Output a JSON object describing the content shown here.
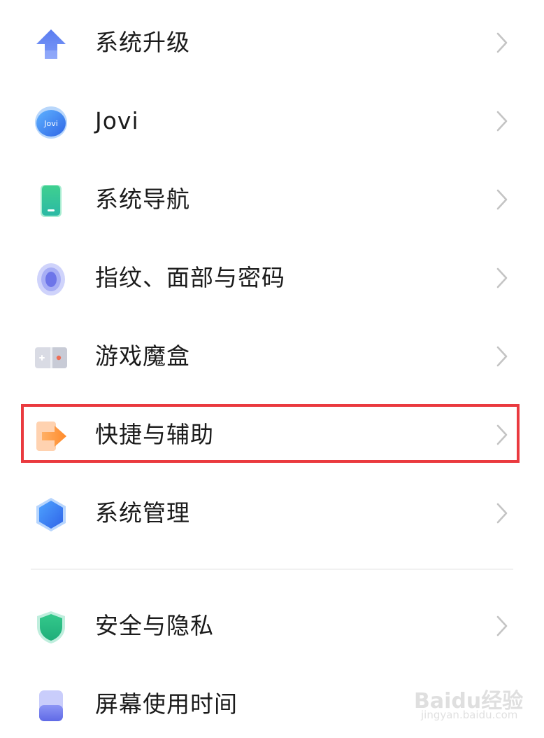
{
  "settings": {
    "items": [
      {
        "label": "系统升级",
        "icon": "arrow-up-icon"
      },
      {
        "label": "Jovi",
        "icon": "jovi-icon",
        "icon_text": "Jovi"
      },
      {
        "label": "系统导航",
        "icon": "phone-icon"
      },
      {
        "label": "指纹、面部与密码",
        "icon": "fingerprint-icon"
      },
      {
        "label": "游戏魔盒",
        "icon": "game-box-icon"
      },
      {
        "label": "快捷与辅助",
        "icon": "shortcut-arrow-icon"
      },
      {
        "label": "系统管理",
        "icon": "hexagon-icon"
      },
      {
        "label": "安全与隐私",
        "icon": "shield-icon"
      },
      {
        "label": "屏幕使用时间",
        "icon": "hourglass-icon"
      }
    ],
    "highlighted_item": "快捷与辅助"
  },
  "watermark": {
    "main": "Baidu经验",
    "sub": "jingyan.baidu.com"
  },
  "colors": {
    "highlight_border": "#ea3a3f",
    "text": "#1b1b1b",
    "chevron": "#c4c4c4"
  }
}
